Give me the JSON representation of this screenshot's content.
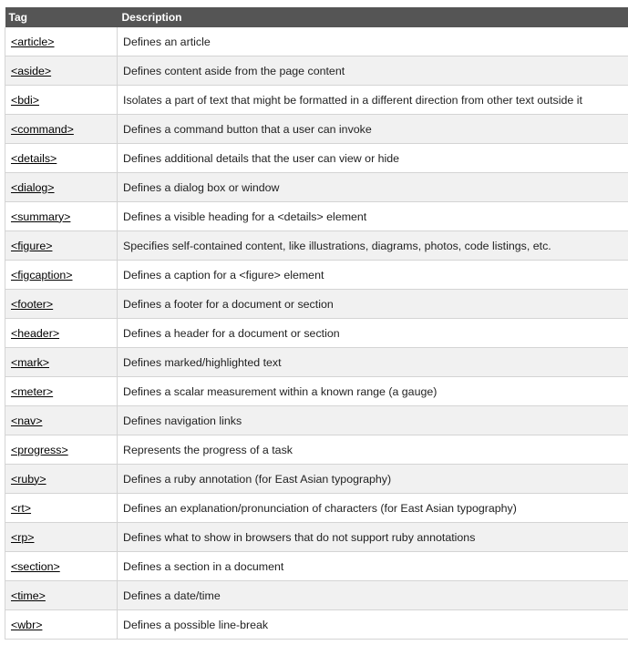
{
  "table": {
    "headers": [
      "Tag",
      "Description"
    ],
    "rows": [
      {
        "tag": "<article>",
        "desc": "Defines an article"
      },
      {
        "tag": "<aside>",
        "desc": "Defines content aside from the page content"
      },
      {
        "tag": "<bdi>",
        "desc": "Isolates a part of text that might be formatted in a different direction from other text outside it"
      },
      {
        "tag": "<command>",
        "desc": "Defines a command button that a user can invoke"
      },
      {
        "tag": "<details>",
        "desc": "Defines additional details that the user can view or hide"
      },
      {
        "tag": "<dialog>",
        "desc": "Defines a dialog box or window"
      },
      {
        "tag": "<summary>",
        "desc": "Defines a visible heading for a <details> element"
      },
      {
        "tag": "<figure>",
        "desc": "Specifies self-contained content, like illustrations, diagrams, photos, code listings, etc."
      },
      {
        "tag": "<figcaption>",
        "desc": "Defines a caption for a <figure> element"
      },
      {
        "tag": "<footer>",
        "desc": "Defines a footer for a document or section"
      },
      {
        "tag": "<header>",
        "desc": "Defines a header for a document or section"
      },
      {
        "tag": "<mark>",
        "desc": "Defines marked/highlighted text"
      },
      {
        "tag": "<meter>",
        "desc": "Defines a scalar measurement within a known range (a gauge)"
      },
      {
        "tag": "<nav>",
        "desc": "Defines navigation links"
      },
      {
        "tag": "<progress>",
        "desc": "Represents the progress of a task"
      },
      {
        "tag": "<ruby>",
        "desc": "Defines a ruby annotation (for East Asian typography)"
      },
      {
        "tag": "<rt>",
        "desc": "Defines an explanation/pronunciation of characters (for East Asian typography)"
      },
      {
        "tag": "<rp>",
        "desc": "Defines what to show in browsers that do not support ruby annotations"
      },
      {
        "tag": "<section>",
        "desc": "Defines a section in a document"
      },
      {
        "tag": "<time>",
        "desc": "Defines a date/time"
      },
      {
        "tag": "<wbr>",
        "desc": "Defines a possible line-break"
      }
    ]
  },
  "colors": {
    "header_bg": "#555555",
    "header_text": "#ffffff",
    "row_alt_bg": "#f1f1f1",
    "border": "#d4d4d4"
  }
}
